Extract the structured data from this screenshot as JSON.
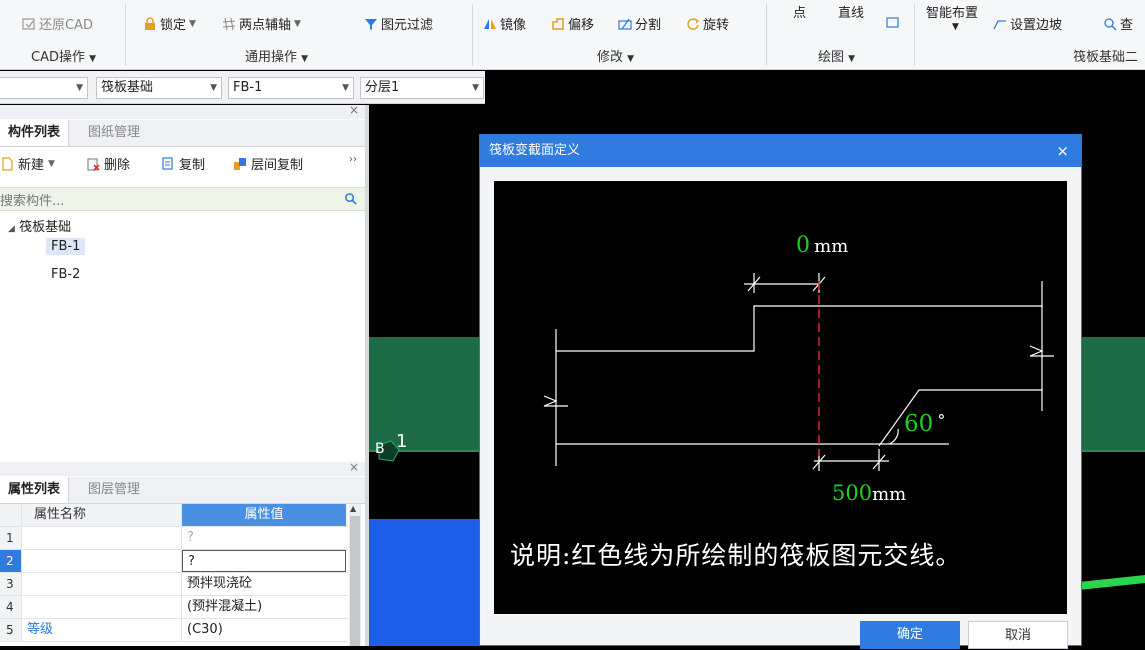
{
  "ribbon": {
    "cad_group": {
      "restore_cad": "还原CAD",
      "label": "CAD操作"
    },
    "general_group": {
      "lock": "锁定",
      "two_point_axis": "两点辅轴",
      "filter": "图元过滤",
      "label": "通用操作"
    },
    "modify_group": {
      "mirror": "镜像",
      "offset": "偏移",
      "split": "分割",
      "rotate": "旋转",
      "label": "修改"
    },
    "draw_group": {
      "point": "点",
      "line": "直线",
      "label": "绘图"
    },
    "raft_group": {
      "smart_layout": "智能布置",
      "set_slope": "设置边坡",
      "check": "查",
      "label": "筏板基础二"
    }
  },
  "selectors": {
    "type": "筏板基础",
    "name": "FB-1",
    "layer": "分层1"
  },
  "component_panel": {
    "tabs": [
      "构件列表",
      "图纸管理"
    ],
    "toolbar": {
      "new": "新建",
      "delete": "删除",
      "copy": "复制",
      "floor_copy": "层间复制"
    },
    "search_placeholder": "搜索构件...",
    "tree": {
      "root": "筏板基础",
      "items": [
        "FB-1",
        "FB-2"
      ]
    }
  },
  "property_panel": {
    "tabs": [
      "属性列表",
      "图层管理"
    ],
    "headers": {
      "name": "属性名称",
      "value": "属性值"
    },
    "rows": [
      {
        "num": "1",
        "name": "",
        "value": "?"
      },
      {
        "num": "2",
        "name": "",
        "value": "?"
      },
      {
        "num": "3",
        "name": "",
        "value": "预拌现浇砼"
      },
      {
        "num": "4",
        "name": "",
        "value": "(预拌混凝土)"
      },
      {
        "num": "5",
        "name": "等级",
        "value": "(C30)"
      }
    ]
  },
  "canvas": {
    "axis_label": "1",
    "axis_prefix": "B"
  },
  "dialog": {
    "title": "筏板变截面定义",
    "close": "×",
    "figure": {
      "top_dim_value": "0",
      "top_dim_unit": "mm",
      "angle_value": "60",
      "angle_unit": "°",
      "bottom_dim_value": "500",
      "bottom_dim_unit": "mm",
      "note": "说明:红色线为所绘制的筏板图元交线。"
    },
    "ok": "确定",
    "cancel": "取消"
  },
  "colors": {
    "accent": "#2f7be0",
    "green_value": "#19d419",
    "red_line": "#e0202a",
    "slab_green": "#1e6b45"
  }
}
